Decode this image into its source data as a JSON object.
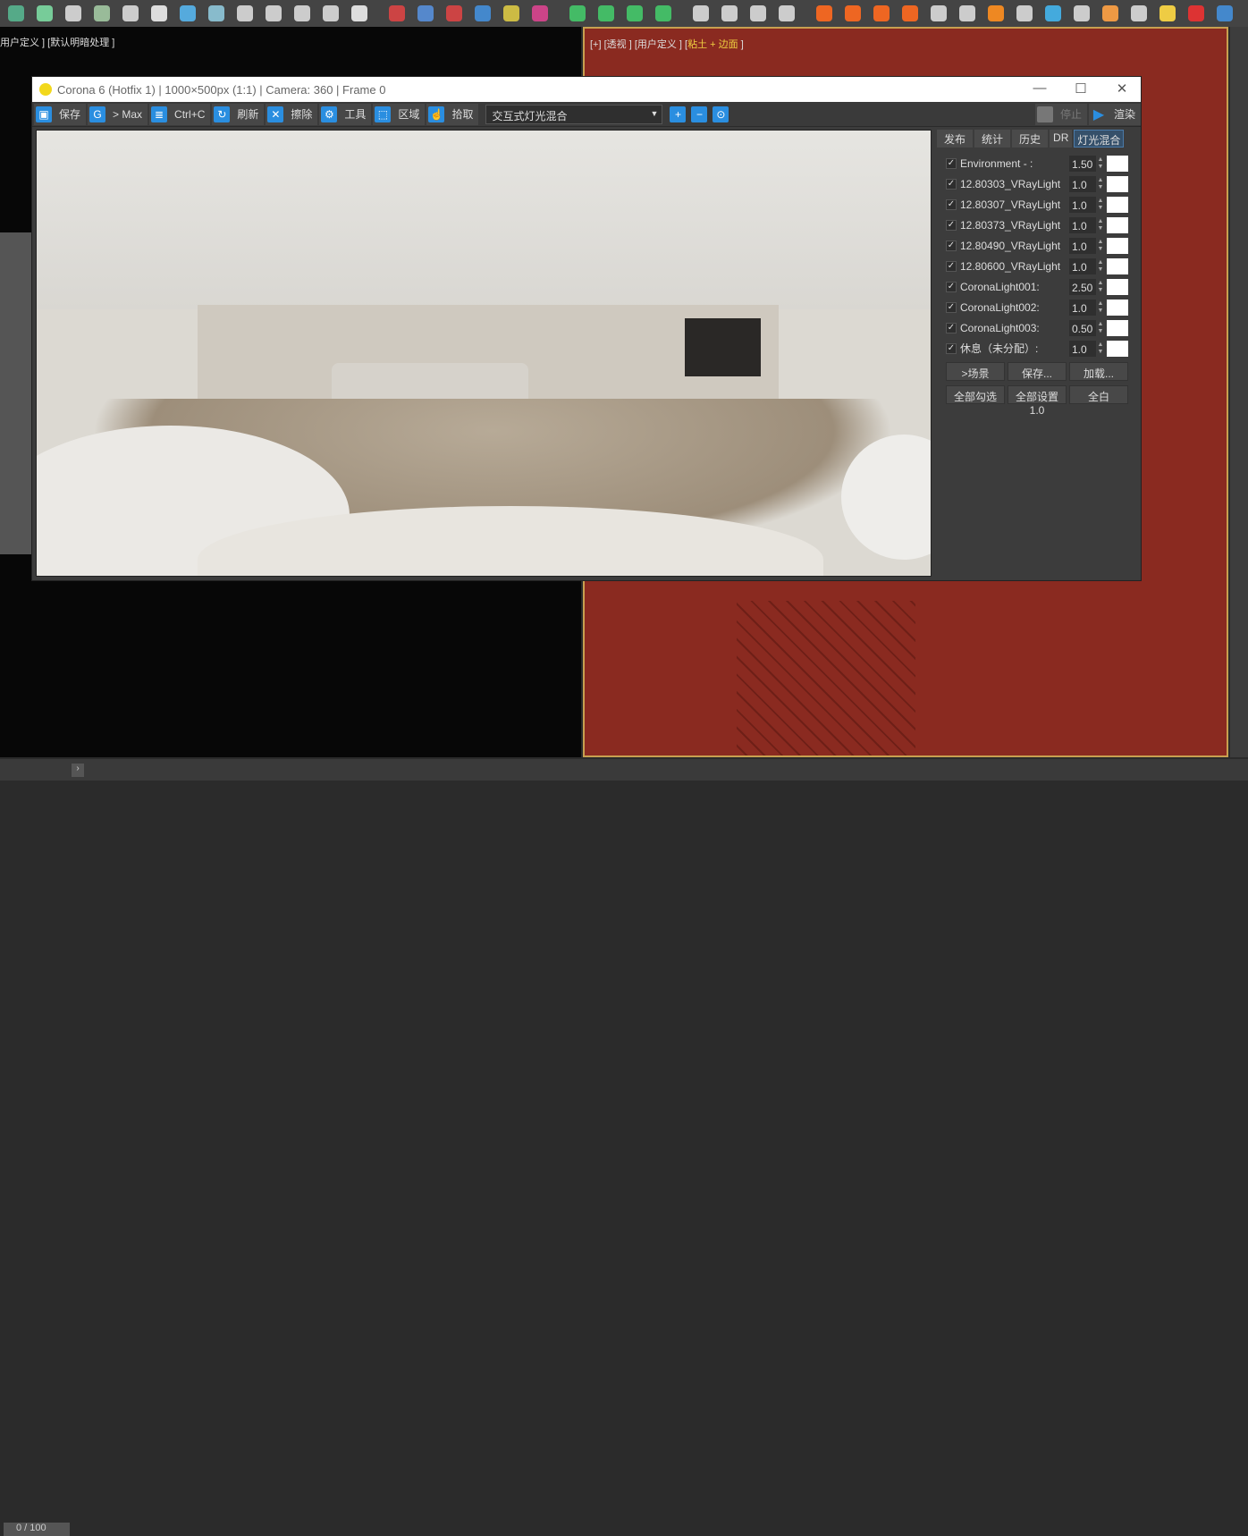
{
  "top_toolbar": {
    "icons": [
      "create-icon",
      "tree-icon",
      "book-icon",
      "pine-icon",
      "bonsai-icon",
      "rotate-icon",
      "map-icon",
      "layout-icon",
      "film-icon",
      "camera-icon",
      "box-icon",
      "bowl-icon",
      "bulb-icon",
      "cube-red-icon",
      "cube-blue-icon",
      "fire-icon",
      "water-icon",
      "circles-icon",
      "cube-pink-icon",
      "move-icon",
      "arrow-icon",
      "grid-icon",
      "star-icon",
      "play-icon",
      "pause-icon",
      "stop-icon",
      "trash-icon",
      "flame1-icon",
      "flame2-icon",
      "flame3-icon",
      "flame4-icon",
      "gear-icon",
      "s-icon",
      "flame5-icon",
      "cloud-icon",
      "drop-icon",
      "jar-icon",
      "cup-icon",
      "bowl2-icon",
      "lamp-icon",
      "tomato-icon",
      "c-icon"
    ],
    "colors": [
      "#5a8",
      "#7c9",
      "#ccc",
      "#9b9",
      "#ccc",
      "#ddd",
      "#5ad",
      "#8bc",
      "#ccc",
      "#ccc",
      "#ccc",
      "#ccc",
      "#ddd",
      "#c44",
      "#58c",
      "#c44",
      "#48c",
      "#cb4",
      "#c48",
      "#4b6",
      "#4b6",
      "#4b6",
      "#4b6",
      "#ccc",
      "#ccc",
      "#ccc",
      "#ccc",
      "#e62",
      "#e62",
      "#e62",
      "#e62",
      "#ccc",
      "#ccc",
      "#e82",
      "#ccc",
      "#4ad",
      "#ccc",
      "#e94",
      "#ccc",
      "#ec4",
      "#d33",
      "#48c"
    ]
  },
  "viewport_left": {
    "label": "用户定义 ] [默认明暗处理 ]"
  },
  "viewport_right": {
    "label_a": "[+] [透视 ] [用户定义 ] [",
    "label_b": "粘土 + 边面",
    "label_c": " ]"
  },
  "status": {
    "frame": "0 / 100"
  },
  "window": {
    "title": "Corona 6 (Hotfix 1) | 1000×500px (1:1) | Camera: 360 | Frame 0",
    "controls": [
      "—",
      "☐",
      "✕"
    ],
    "toolbar": [
      {
        "icon": "save-icon",
        "glyph": "▣",
        "label": "保存"
      },
      {
        "icon": "max-icon",
        "glyph": "G",
        "label": "> Max"
      },
      {
        "icon": "copy-icon",
        "glyph": "≣",
        "label": "Ctrl+C"
      },
      {
        "icon": "refresh-icon",
        "glyph": "↻",
        "label": "刷新"
      },
      {
        "icon": "clear-icon",
        "glyph": "✕",
        "label": "擦除"
      },
      {
        "icon": "tools-icon",
        "glyph": "⚙",
        "label": "工具"
      },
      {
        "icon": "region-icon",
        "glyph": "⬚",
        "label": "区域"
      },
      {
        "icon": "pick-icon",
        "glyph": "☝",
        "label": "拾取"
      }
    ],
    "channel": "交互式灯光混合",
    "stop_label": "停止",
    "render_label": "渲染",
    "tabs": [
      "发布",
      "统计",
      "历史",
      "DR",
      "灯光混合"
    ],
    "lights": [
      {
        "name": "Environment - :",
        "value": "1.50"
      },
      {
        "name": "12.80303_VRayLight",
        "value": "1.0"
      },
      {
        "name": "12.80307_VRayLight",
        "value": "1.0"
      },
      {
        "name": "12.80373_VRayLight",
        "value": "1.0"
      },
      {
        "name": "12.80490_VRayLight",
        "value": "1.0"
      },
      {
        "name": "12.80600_VRayLight",
        "value": "1.0"
      },
      {
        "name": "CoronaLight001:",
        "value": "2.50"
      },
      {
        "name": "CoronaLight002:",
        "value": "1.0"
      },
      {
        "name": "CoronaLight003:",
        "value": "0.50"
      },
      {
        "name": "休息（未分配）:",
        "value": "1.0"
      }
    ],
    "buttons_row1": [
      ">场景",
      "保存...",
      "加载..."
    ],
    "buttons_row2": [
      "全部勾选",
      "全部设置1.0",
      "全白"
    ]
  }
}
